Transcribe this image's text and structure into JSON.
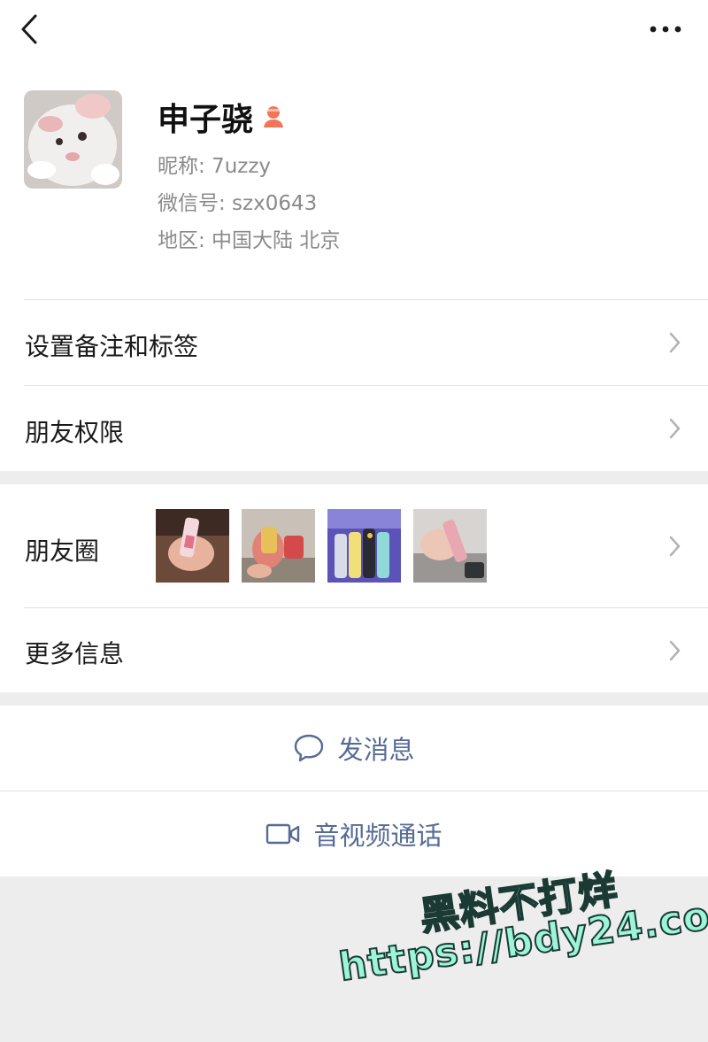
{
  "profile": {
    "name": "申子骁",
    "nickname_line": "昵称:  7uzzy",
    "wechat_id_line": "微信号:  szx0643",
    "region_line": "地区:  中国大陆  北京"
  },
  "menu": {
    "remark_tags": "设置备注和标签",
    "friend_permissions": "朋友权限",
    "moments": "朋友圈",
    "more_info": "更多信息"
  },
  "actions": {
    "send_message": "发消息",
    "video_call": "音视频通话"
  },
  "watermark": {
    "line1": "黑料不打烊",
    "line2": "https://bdy24.co"
  },
  "icons": {
    "back": "chevron-left-icon",
    "more": "more-dots-icon",
    "gender": "female-user-icon",
    "chevron": "chevron-right-icon",
    "message": "chat-bubble-icon",
    "video": "video-camera-icon"
  },
  "colors": {
    "link": "#576b95",
    "gender_icon": "#f0765a",
    "watermark_fill": "#9df5d8"
  }
}
